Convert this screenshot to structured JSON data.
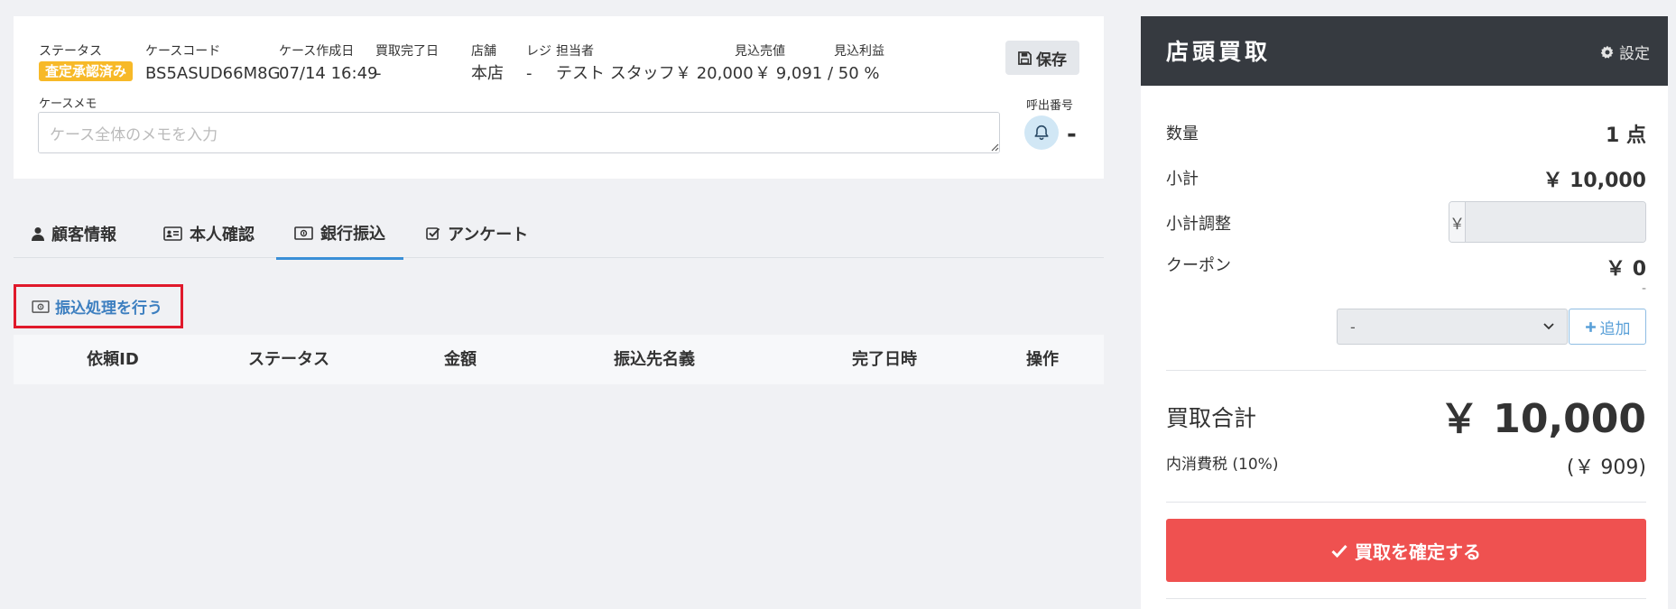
{
  "case": {
    "status": {
      "label": "ステータス",
      "value": "査定承認済み"
    },
    "case_code": {
      "label": "ケースコード",
      "value": "BS5ASUD66M8G"
    },
    "created": {
      "label": "ケース作成日",
      "value": "07/14 16:49"
    },
    "completed": {
      "label": "買取完了日",
      "value": "-"
    },
    "store": {
      "label": "店舗",
      "value": "本店"
    },
    "register": {
      "label": "レジ",
      "value": "-"
    },
    "staff": {
      "label": "担当者",
      "value": "テスト スタッフ"
    },
    "expected_price": {
      "label": "見込売値",
      "value": "￥ 20,000"
    },
    "expected_profit": {
      "label": "見込利益",
      "value": "￥ 9,091 / 50 %"
    },
    "save_label": "保存",
    "memo_label": "ケースメモ",
    "memo_placeholder": "ケース全体のメモを入力",
    "memo_value": "",
    "call_label": "呼出番号",
    "call_value": "-"
  },
  "tabs": [
    {
      "label": "顧客情報",
      "icon": "user-icon",
      "active": false
    },
    {
      "label": "本人確認",
      "icon": "id-card-icon",
      "active": false
    },
    {
      "label": "銀行振込",
      "icon": "money-bill-icon",
      "active": true
    },
    {
      "label": "アンケート",
      "icon": "check-square-icon",
      "active": false
    }
  ],
  "transfer": {
    "action_label": "振込処理を行う",
    "columns": [
      "依頼ID",
      "ステータス",
      "金額",
      "振込先名義",
      "完了日時",
      "操作"
    ]
  },
  "panel": {
    "title": "店頭買取",
    "settings_label": "設定",
    "quantity_label": "数量",
    "quantity_value": "1 点",
    "subtotal_label": "小計",
    "subtotal_value": "￥ 10,000",
    "adjust_label": "小計調整",
    "adjust_prefix": "￥",
    "adjust_value": "",
    "coupon_label": "クーポン",
    "coupon_value": "￥ 0",
    "coupon_dash": "-",
    "coupon_select": "-",
    "coupon_add_label": "追加",
    "total_label": "買取合計",
    "total_value": "￥ 10,000",
    "tax_label": "内消費税 (10%)",
    "tax_value": "(￥ 909)",
    "confirm_label": "買取を確定する"
  },
  "colors": {
    "badge": "#f7b928",
    "accent": "#3a8fd7",
    "panel_header": "#363a40",
    "confirm": "#ef5150",
    "highlight_box": "#e0192b"
  }
}
